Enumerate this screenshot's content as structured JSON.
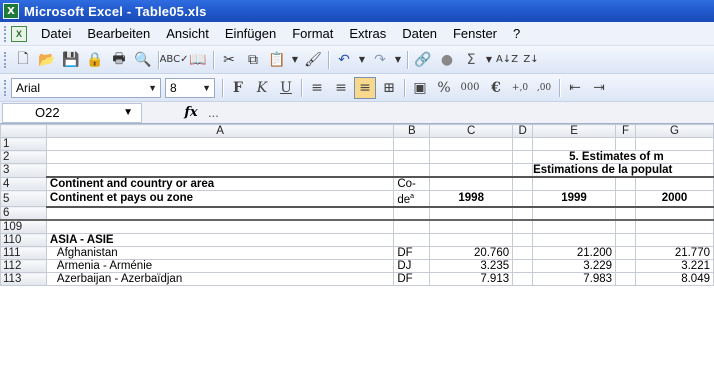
{
  "window": {
    "title": "Microsoft Excel - Table05.xls",
    "app_icon": "X"
  },
  "menu": [
    "Datei",
    "Bearbeiten",
    "Ansicht",
    "Einfügen",
    "Format",
    "Extras",
    "Daten",
    "Fenster",
    "?"
  ],
  "toolbar": {
    "font_name": "Arial",
    "font_size": "8",
    "percent": "%",
    "thousands": "000",
    "euro": "€"
  },
  "formula_bar": {
    "name_box": "O22",
    "fx": "fx",
    "content": "..."
  },
  "columns": [
    "",
    "A",
    "B",
    "C",
    "D",
    "E",
    "F",
    "G"
  ],
  "rows": [
    {
      "num": "1",
      "cells": [
        "",
        "",
        "",
        "",
        "",
        "",
        ""
      ]
    },
    {
      "num": "2",
      "cells": [
        "",
        "",
        "",
        "",
        "5. Estimates of m",
        "",
        ""
      ]
    },
    {
      "num": "3",
      "cells": [
        "",
        "",
        "",
        "",
        "Estimations de la populat",
        "",
        ""
      ]
    },
    {
      "num": "4",
      "cells": [
        "Continent and country or area",
        "Co-",
        "",
        "",
        "",
        "",
        ""
      ]
    },
    {
      "num": "5",
      "cells": [
        "Continent et pays ou zone",
        "de",
        "1998",
        "",
        "1999",
        "",
        "2000"
      ]
    },
    {
      "num": "6",
      "cells": [
        "",
        "",
        "",
        "",
        "",
        "",
        ""
      ]
    },
    {
      "num": "109",
      "cells": [
        "",
        "",
        "",
        "",
        "",
        "",
        ""
      ]
    },
    {
      "num": "110",
      "cells": [
        "ASIA - ASIE",
        "",
        "",
        "",
        "",
        "",
        ""
      ]
    },
    {
      "num": "111",
      "cells": [
        "Afghanistan",
        "DF",
        "20.760",
        "",
        "21.200",
        "",
        "21.770"
      ]
    },
    {
      "num": "112",
      "cells": [
        "Armenia - Arménie",
        "DJ",
        "3.235",
        "",
        "3.229",
        "",
        "3.221"
      ]
    },
    {
      "num": "113",
      "cells": [
        "Azerbaijan - Azerbaïdjan",
        "DF",
        "7.913",
        "",
        "7.983",
        "",
        "8.049"
      ]
    }
  ],
  "superscript": "a"
}
